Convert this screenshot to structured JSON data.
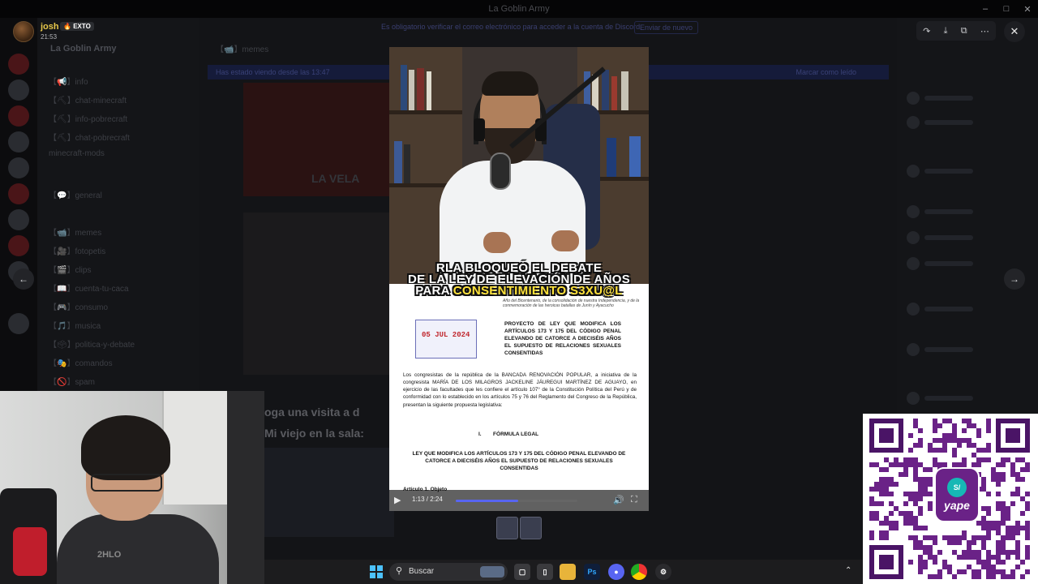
{
  "window": {
    "title": "La Goblin Army"
  },
  "viewer": {
    "user": {
      "name": "josh",
      "tag": "EXTO",
      "time": "21:53"
    },
    "notice": "Es obligatorio verificar el correo electrónico para acceder a la cuenta de Discord.",
    "notice_button": "Enviar de nuevo",
    "tools": {
      "forward_icon": "forward-icon",
      "download_icon": "download-icon",
      "open_icon": "open-external-icon",
      "more_icon": "more-icon"
    }
  },
  "background": {
    "server_name": "La Goblin Army",
    "channels": [
      "【📢】info",
      "【⛏】chat-minecraft",
      "【⛏】info-pobrecraft",
      "【⛏】chat-pobrecraft",
      "minecraft-mods",
      "【💬】general",
      "【📹】memes",
      "【🎥】fotopetis",
      "【🎬】clips",
      "【📖】cuenta-tu-caca",
      "【🎮】consumo",
      "【🎵】musica",
      "【🗳】politica-y-debate",
      "【🎭】comandos",
      "【🚫】spam"
    ],
    "chat_header": "【📹】memes",
    "banner_left": "Has estado viendo desde las 13:47",
    "banner_right": "Marcar como leído",
    "post_text_1": "LA VELA",
    "post_text_2": "oga una visita a d",
    "post_text_3": "Mi viejo en la sala:"
  },
  "video": {
    "caption_line1": "RLA BLOQUEÓ EL DEBATE",
    "caption_line2": "DE LA LEY DE ELEVACIÓN DE AÑOS",
    "caption_line3_white": "PARA",
    "caption_line3_yellow": "CONSENTIMIENTO S3XU@L",
    "doc": {
      "header_italic": "Año del Bicentenario, de la consolidación de nuestra Independencia, y de la conmemoración de las heroicas batallas de Junín y Ayacucho",
      "stamp_date": "05 JUL 2024",
      "title": "PROYECTO DE LEY QUE MODIFICA LOS ARTÍCULOS 173 Y 175 DEL CÓDIGO PENAL ELEVANDO DE CATORCE A DIECISÉIS AÑOS EL SUPUESTO DE RELACIONES SEXUALES CONSENTIDAS",
      "body": "Los congresistas de la república de la BANCADA RENOVACIÓN POPULAR, a iniciativa de la congresista MARÍA DE LOS MILAGROS JACKELINE JÁUREGUI MARTÍNEZ DE AGUAYO, en ejercicio de las facultades que les confiere el artículo 107° de la Constitución Política del Perú y de conformidad con lo establecido en los artículos 75 y 76 del Reglamento del Congreso de la República, presentan la siguiente propuesta legislativa:",
      "section": "I.        FÓRMULA LEGAL",
      "law_title": "LEY QUE MODIFICA LOS ARTÍCULOS 173 Y 175 DEL CÓDIGO PENAL ELEVANDO DE CATORCE A DIECISÉIS AÑOS EL SUPUESTO DE RELACIONES SEXUALES CONSENTIDAS",
      "article": "Artículo 1. Objeto"
    },
    "player": {
      "time": "1:13 / 2:24",
      "progress": 0.51
    }
  },
  "webcam": {
    "shirt_text": "2HLO"
  },
  "qr": {
    "brand": "yape",
    "symbol": "S/"
  },
  "taskbar": {
    "search_label": "Buscar",
    "apps": [
      "file-explorer-icon",
      "ps",
      "discord-icon",
      "chrome-icon",
      "steam-icon"
    ],
    "colors": {
      "accent": "#4cc2ff",
      "discord": "#5865f2",
      "yape": "#6a2287"
    }
  }
}
